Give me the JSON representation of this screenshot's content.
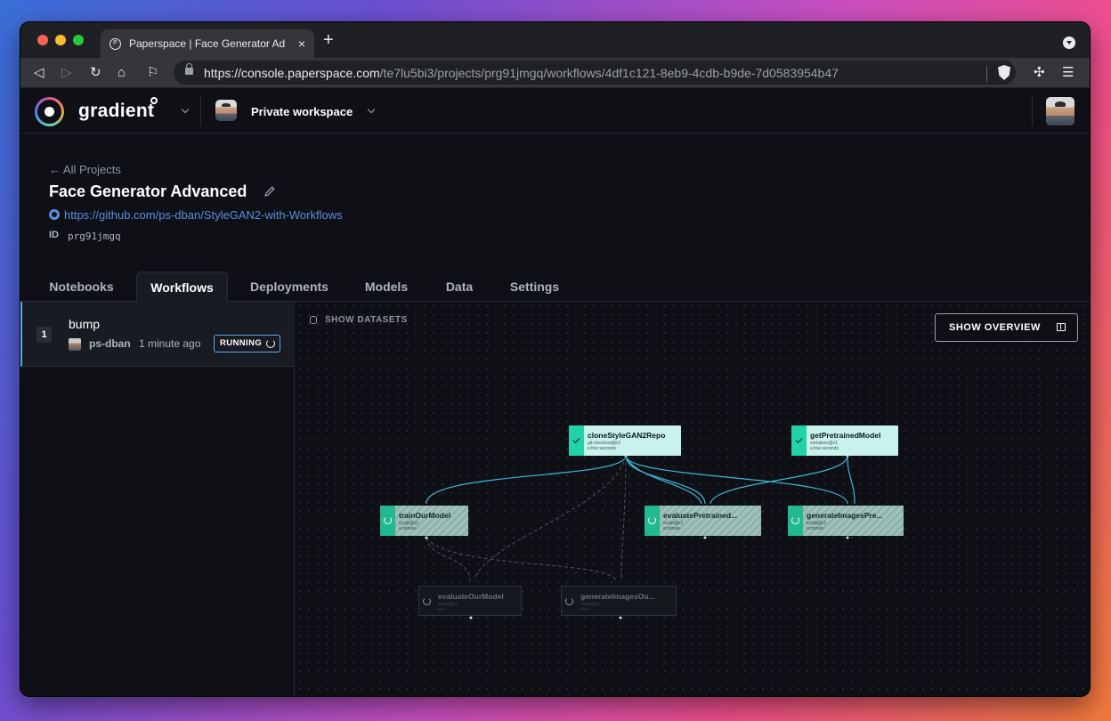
{
  "browser": {
    "tab_title": "Paperspace | Face Generator Advanced",
    "new_tab": "+",
    "close": "×",
    "url_host": "https://console.paperspace.com",
    "url_path": "/te7lu5bi3/projects/prg91jmgq/workflows/4df1c121-8eb9-4cdb-b9de-7d0583954b47"
  },
  "header": {
    "brand": "gradient",
    "workspace": "Private workspace"
  },
  "project": {
    "back_link": "← All Projects",
    "title": "Face Generator Advanced",
    "repo": "https://github.com/ps-dban/StyleGAN2-with-Workflows",
    "id_label": "ID",
    "id_value": "prg91jmgq"
  },
  "tabs": [
    "Notebooks",
    "Workflows",
    "Deployments",
    "Models",
    "Data",
    "Settings"
  ],
  "runs": [
    {
      "number": "1",
      "name": "bump",
      "user": "ps-dban",
      "time": "1 minute ago",
      "status": "RUNNING"
    }
  ],
  "canvas": {
    "show_datasets": "SHOW DATASETS",
    "show_overview": "SHOW OVERVIEW"
  },
  "nodes": [
    {
      "name": "cloneStyleGAN2Repo",
      "sub1": "git-checkout@v1",
      "sub2": "a few seconds",
      "state": "done"
    },
    {
      "name": "getPretrainedModel",
      "sub1": "container@v1",
      "sub2": "a few seconds",
      "state": "done"
    },
    {
      "name": "trainOurModel",
      "sub1": "script@v1",
      "sub2": "a minute",
      "state": "running"
    },
    {
      "name": "evaluatePretrained...",
      "sub1": "script@v1",
      "sub2": "a minute",
      "state": "running"
    },
    {
      "name": "generateImagesPre...",
      "sub1": "script@v1",
      "sub2": "a minute",
      "state": "running"
    },
    {
      "name": "evaluateOurModel",
      "sub1": "script@v1",
      "sub2": "n/a",
      "state": "waiting"
    },
    {
      "name": "generateImagesOu...",
      "sub1": "script@v1",
      "sub2": "n/a",
      "state": "waiting"
    }
  ]
}
